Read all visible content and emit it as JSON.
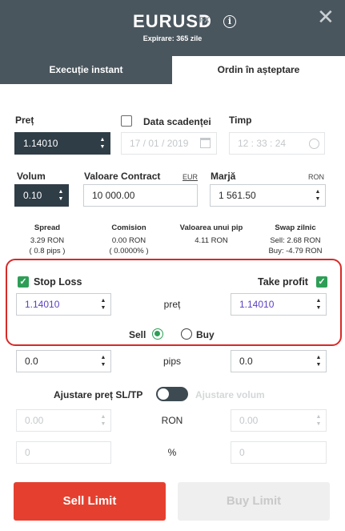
{
  "header": {
    "symbol": "EURUSD",
    "badge": "FX",
    "expiry": "Expirare: 365 zile",
    "info_icon": "info-icon",
    "close_icon": "close-icon"
  },
  "tabs": [
    {
      "label": "Execuție instant"
    },
    {
      "label": "Ordin în așteptare"
    }
  ],
  "order": {
    "price_label": "Preț",
    "price_value": "1.14010",
    "due_date_label": "Data scadenței",
    "due_date_value": "17 / 01 / 2019",
    "time_label": "Timp",
    "time_value": "12 : 33 : 24",
    "volume_label": "Volum",
    "volume_value": "0.10",
    "contract_label": "Valoare Contract",
    "contract_currency": "EUR",
    "contract_value": "10 000.00",
    "margin_label": "Marjă",
    "margin_currency": "RON",
    "margin_value": "1 561.50"
  },
  "stats": {
    "spread": {
      "label": "Spread",
      "value": "3.29 RON",
      "sub": "( 0.8 pips )"
    },
    "commission": {
      "label": "Comision",
      "value": "0.00 RON",
      "sub": "( 0.0000% )"
    },
    "pip_value": {
      "label": "Valoarea unui pip",
      "value": "4.11 RON"
    },
    "swap": {
      "label": "Swap zilnic",
      "sell": "Sell: 2.68 RON",
      "buy": "Buy: -4.79 RON"
    }
  },
  "sltp": {
    "stop_loss_label": "Stop Loss",
    "take_profit_label": "Take profit",
    "sl_price": "1.14010",
    "tp_price": "1.14010",
    "price_label": "preț",
    "sell_label": "Sell",
    "buy_label": "Buy",
    "selected_side": "Sell",
    "sl_pips": "0.0",
    "tp_pips": "0.0",
    "pips_label": "pips",
    "adjust_price_label": "Ajustare preț SL/TP",
    "adjust_volume_label": "Ajustare volum",
    "sl_ron": "0.00",
    "tp_ron": "0.00",
    "ron_label": "RON",
    "sl_pct": "0",
    "tp_pct": "0",
    "pct_label": "%"
  },
  "actions": {
    "sell_limit": "Sell Limit",
    "buy_limit": "Buy Limit"
  },
  "colors": {
    "header_bg": "#4a565e",
    "sell": "#e5402f",
    "check": "#2e9e57",
    "highlight_border": "#d72a28",
    "price_text": "#5b3fc4"
  }
}
